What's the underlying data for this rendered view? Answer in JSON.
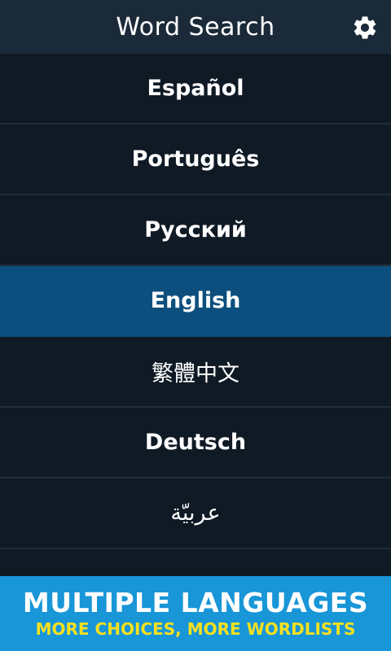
{
  "header": {
    "title": "Word Search",
    "settings_icon": "gear-icon"
  },
  "languages": [
    {
      "label": "Español",
      "selected": false
    },
    {
      "label": "Português",
      "selected": false
    },
    {
      "label": "Русский",
      "selected": false
    },
    {
      "label": "English",
      "selected": true
    },
    {
      "label": "繁體中文",
      "selected": false
    },
    {
      "label": "Deutsch",
      "selected": false
    },
    {
      "label": "عربيّة",
      "selected": false
    }
  ],
  "banner": {
    "title": "MULTIPLE LANGUAGES",
    "subtitle": "MORE CHOICES, MORE WORDLISTS"
  },
  "colors": {
    "background": "#0f1a25",
    "header": "#1b2a38",
    "selected": "#0c4f7e",
    "banner": "#1896d8",
    "banner_subtitle": "#f6e11f"
  }
}
